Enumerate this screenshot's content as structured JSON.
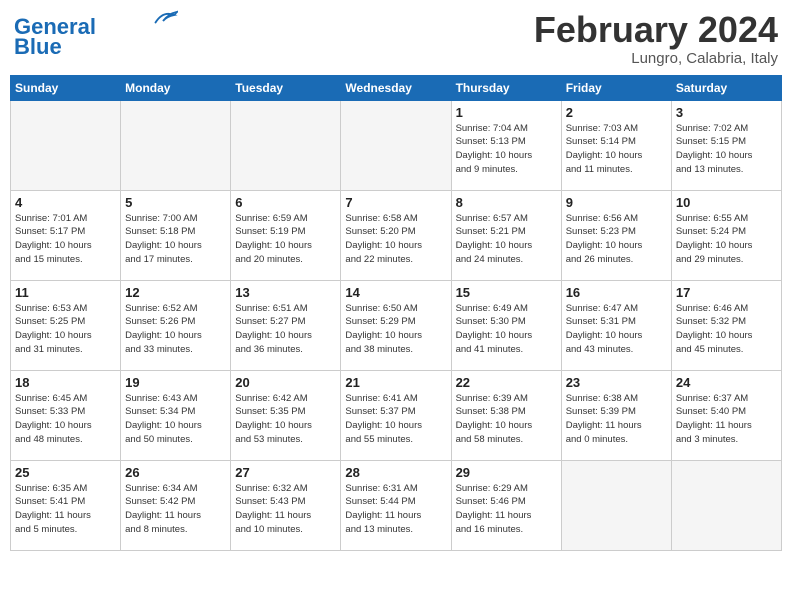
{
  "header": {
    "logo_line1": "General",
    "logo_line2": "Blue",
    "title": "February 2024",
    "subtitle": "Lungro, Calabria, Italy"
  },
  "weekdays": [
    "Sunday",
    "Monday",
    "Tuesday",
    "Wednesday",
    "Thursday",
    "Friday",
    "Saturday"
  ],
  "weeks": [
    [
      {
        "day": "",
        "info": ""
      },
      {
        "day": "",
        "info": ""
      },
      {
        "day": "",
        "info": ""
      },
      {
        "day": "",
        "info": ""
      },
      {
        "day": "1",
        "info": "Sunrise: 7:04 AM\nSunset: 5:13 PM\nDaylight: 10 hours\nand 9 minutes."
      },
      {
        "day": "2",
        "info": "Sunrise: 7:03 AM\nSunset: 5:14 PM\nDaylight: 10 hours\nand 11 minutes."
      },
      {
        "day": "3",
        "info": "Sunrise: 7:02 AM\nSunset: 5:15 PM\nDaylight: 10 hours\nand 13 minutes."
      }
    ],
    [
      {
        "day": "4",
        "info": "Sunrise: 7:01 AM\nSunset: 5:17 PM\nDaylight: 10 hours\nand 15 minutes."
      },
      {
        "day": "5",
        "info": "Sunrise: 7:00 AM\nSunset: 5:18 PM\nDaylight: 10 hours\nand 17 minutes."
      },
      {
        "day": "6",
        "info": "Sunrise: 6:59 AM\nSunset: 5:19 PM\nDaylight: 10 hours\nand 20 minutes."
      },
      {
        "day": "7",
        "info": "Sunrise: 6:58 AM\nSunset: 5:20 PM\nDaylight: 10 hours\nand 22 minutes."
      },
      {
        "day": "8",
        "info": "Sunrise: 6:57 AM\nSunset: 5:21 PM\nDaylight: 10 hours\nand 24 minutes."
      },
      {
        "day": "9",
        "info": "Sunrise: 6:56 AM\nSunset: 5:23 PM\nDaylight: 10 hours\nand 26 minutes."
      },
      {
        "day": "10",
        "info": "Sunrise: 6:55 AM\nSunset: 5:24 PM\nDaylight: 10 hours\nand 29 minutes."
      }
    ],
    [
      {
        "day": "11",
        "info": "Sunrise: 6:53 AM\nSunset: 5:25 PM\nDaylight: 10 hours\nand 31 minutes."
      },
      {
        "day": "12",
        "info": "Sunrise: 6:52 AM\nSunset: 5:26 PM\nDaylight: 10 hours\nand 33 minutes."
      },
      {
        "day": "13",
        "info": "Sunrise: 6:51 AM\nSunset: 5:27 PM\nDaylight: 10 hours\nand 36 minutes."
      },
      {
        "day": "14",
        "info": "Sunrise: 6:50 AM\nSunset: 5:29 PM\nDaylight: 10 hours\nand 38 minutes."
      },
      {
        "day": "15",
        "info": "Sunrise: 6:49 AM\nSunset: 5:30 PM\nDaylight: 10 hours\nand 41 minutes."
      },
      {
        "day": "16",
        "info": "Sunrise: 6:47 AM\nSunset: 5:31 PM\nDaylight: 10 hours\nand 43 minutes."
      },
      {
        "day": "17",
        "info": "Sunrise: 6:46 AM\nSunset: 5:32 PM\nDaylight: 10 hours\nand 45 minutes."
      }
    ],
    [
      {
        "day": "18",
        "info": "Sunrise: 6:45 AM\nSunset: 5:33 PM\nDaylight: 10 hours\nand 48 minutes."
      },
      {
        "day": "19",
        "info": "Sunrise: 6:43 AM\nSunset: 5:34 PM\nDaylight: 10 hours\nand 50 minutes."
      },
      {
        "day": "20",
        "info": "Sunrise: 6:42 AM\nSunset: 5:35 PM\nDaylight: 10 hours\nand 53 minutes."
      },
      {
        "day": "21",
        "info": "Sunrise: 6:41 AM\nSunset: 5:37 PM\nDaylight: 10 hours\nand 55 minutes."
      },
      {
        "day": "22",
        "info": "Sunrise: 6:39 AM\nSunset: 5:38 PM\nDaylight: 10 hours\nand 58 minutes."
      },
      {
        "day": "23",
        "info": "Sunrise: 6:38 AM\nSunset: 5:39 PM\nDaylight: 11 hours\nand 0 minutes."
      },
      {
        "day": "24",
        "info": "Sunrise: 6:37 AM\nSunset: 5:40 PM\nDaylight: 11 hours\nand 3 minutes."
      }
    ],
    [
      {
        "day": "25",
        "info": "Sunrise: 6:35 AM\nSunset: 5:41 PM\nDaylight: 11 hours\nand 5 minutes."
      },
      {
        "day": "26",
        "info": "Sunrise: 6:34 AM\nSunset: 5:42 PM\nDaylight: 11 hours\nand 8 minutes."
      },
      {
        "day": "27",
        "info": "Sunrise: 6:32 AM\nSunset: 5:43 PM\nDaylight: 11 hours\nand 10 minutes."
      },
      {
        "day": "28",
        "info": "Sunrise: 6:31 AM\nSunset: 5:44 PM\nDaylight: 11 hours\nand 13 minutes."
      },
      {
        "day": "29",
        "info": "Sunrise: 6:29 AM\nSunset: 5:46 PM\nDaylight: 11 hours\nand 16 minutes."
      },
      {
        "day": "",
        "info": ""
      },
      {
        "day": "",
        "info": ""
      }
    ]
  ]
}
